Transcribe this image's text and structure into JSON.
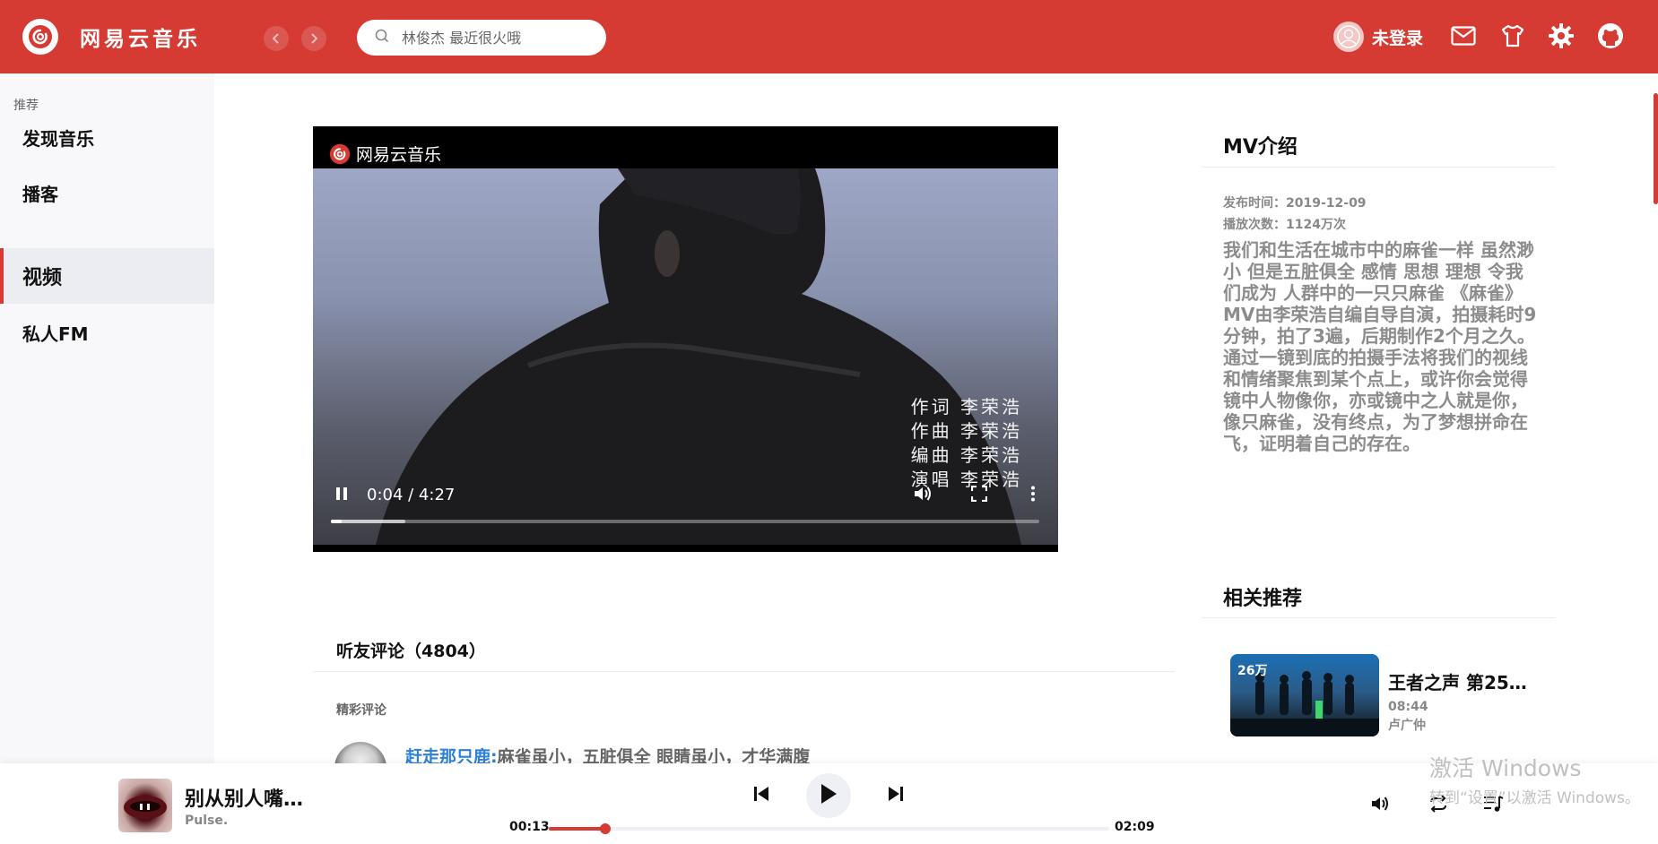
{
  "header": {
    "app_title": "网易云音乐",
    "search_placeholder": "林俊杰 最近很火哦",
    "user_label": "未登录",
    "icons": [
      "back-icon",
      "forward-icon",
      "search-icon",
      "user-icon",
      "mail-icon",
      "shirt-icon",
      "gear-icon",
      "github-icon"
    ],
    "brand_color": "#d53a33"
  },
  "sidebar": {
    "section": "推荐",
    "items": [
      {
        "label": "发现音乐",
        "active": false
      },
      {
        "label": "播客",
        "active": false
      },
      {
        "label": "视频",
        "active": true
      },
      {
        "label": "私人FM",
        "active": false
      }
    ]
  },
  "video": {
    "watermark": "网易云音乐",
    "credits": [
      "作词 李荣浩",
      "作曲 李荣浩",
      "编曲 李荣浩",
      "演唱 李荣浩"
    ],
    "time": "0:04 / 4:27",
    "progress": 0.015,
    "buffered": 0.105
  },
  "comments": {
    "title": "听友评论（4804）",
    "subtitle": "精彩评论",
    "items": [
      {
        "user": "赶走那只鹿:",
        "text": "麻雀虽小，五脏俱全 眼睛虽小，才华满腹"
      }
    ]
  },
  "mv_info": {
    "title": "MV介绍",
    "publish": "发布时间：2019-12-09",
    "plays": "播放次数：1124万次",
    "desc": "我们和生活在城市中的麻雀一样 虽然渺小 但是五脏俱全 感情 思想 理想 令我们成为 人群中的一只只麻雀 《麻雀》MV由李荣浩自编自导自演，拍摄耗时9分钟，拍了3遍，后期制作2个月之久。通过一镜到底的拍摄手法将我们的视线和情绪聚焦到某个点上，或许你会觉得镜中人物像你，亦或镜中之人就是你，像只麻雀，没有终点，为了梦想拼命在飞，证明着自己的存在。"
  },
  "related": {
    "title": "相关推荐",
    "items": [
      {
        "count": "26万",
        "name": "王者之声 第25…",
        "duration": "08:44",
        "artist": "卢广仲"
      }
    ]
  },
  "player": {
    "song": "别从别人嘴…",
    "artist": "Pulse.",
    "current": "00:13",
    "total": "02:09",
    "progress": 0.1
  },
  "watermark": {
    "line1": "激活 Windows",
    "line2": "转到“设置”以激活 Windows。"
  }
}
